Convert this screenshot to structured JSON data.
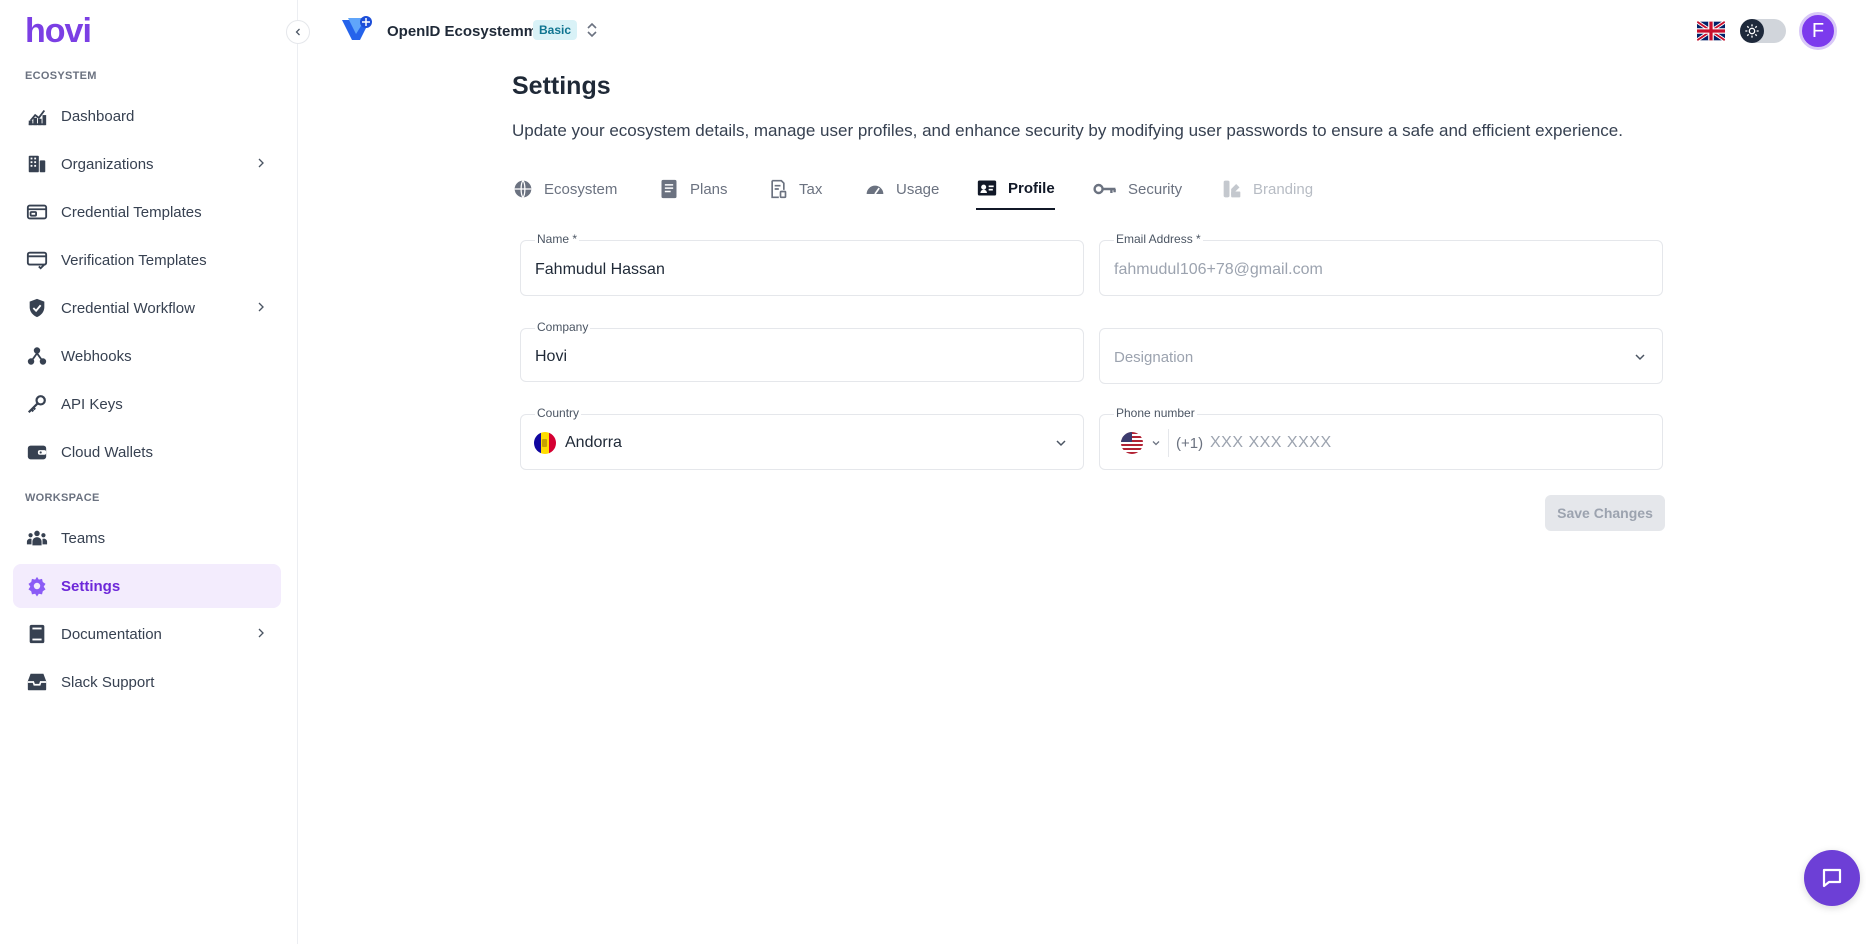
{
  "brand": {
    "logo_text": "hovi",
    "accent": "#7b3fe4"
  },
  "header": {
    "ecosystem_name": "OpenID Ecosystemm",
    "plan_badge": "Basic",
    "avatar_initial": "F"
  },
  "sidebar": {
    "sections": [
      {
        "label": "ECOSYSTEM"
      },
      {
        "label": "WORKSPACE"
      }
    ],
    "items": [
      {
        "label": "Dashboard",
        "icon": "chart-line-icon"
      },
      {
        "label": "Organizations",
        "icon": "building-icon"
      },
      {
        "label": "Credential Templates",
        "icon": "id-card-icon"
      },
      {
        "label": "Verification Templates",
        "icon": "verify-card-icon"
      },
      {
        "label": "Credential Workflow",
        "icon": "shield-check-icon"
      },
      {
        "label": "Webhooks",
        "icon": "webhook-icon"
      },
      {
        "label": "API Keys",
        "icon": "key-icon"
      },
      {
        "label": "Cloud Wallets",
        "icon": "wallet-icon"
      },
      {
        "label": "Teams",
        "icon": "users-icon"
      },
      {
        "label": "Settings",
        "icon": "gear-icon",
        "active": true
      },
      {
        "label": "Documentation",
        "icon": "book-icon"
      },
      {
        "label": "Slack Support",
        "icon": "inbox-icon"
      }
    ]
  },
  "main": {
    "title": "Settings",
    "description": "Update your ecosystem details, manage user profiles, and enhance security by modifying user passwords to ensure a safe and efficient experience.",
    "tabs": [
      {
        "label": "Ecosystem",
        "icon": "globe-icon"
      },
      {
        "label": "Plans",
        "icon": "document-icon"
      },
      {
        "label": "Tax",
        "icon": "receipt-icon"
      },
      {
        "label": "Usage",
        "icon": "gauge-icon"
      },
      {
        "label": "Profile",
        "icon": "profile-card-icon",
        "active": true
      },
      {
        "label": "Security",
        "icon": "key-icon"
      },
      {
        "label": "Branding",
        "icon": "palette-icon",
        "disabled": true
      }
    ],
    "form": {
      "name": {
        "label": "Name *",
        "value": "Fahmudul Hassan"
      },
      "email": {
        "label": "Email Address *",
        "value": "fahmudul106+78@gmail.com"
      },
      "company": {
        "label": "Company",
        "value": "Hovi"
      },
      "designation": {
        "placeholder": "Designation"
      },
      "country": {
        "label": "Country",
        "value": "Andorra"
      },
      "phone": {
        "label": "Phone number",
        "dial_code": "(+1)",
        "placeholder": "XXX XXX XXXX"
      }
    },
    "save_label": "Save Changes"
  }
}
